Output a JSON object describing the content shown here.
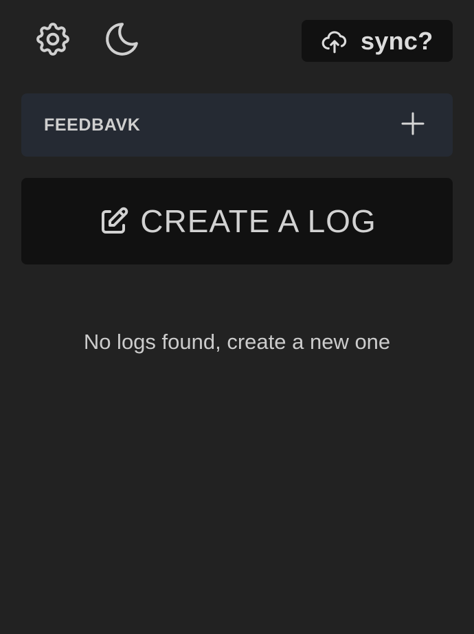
{
  "header": {
    "settings_icon": "gear-icon",
    "theme_icon": "moon-icon",
    "sync": {
      "icon": "cloud-upload-icon",
      "label": "sync?"
    }
  },
  "section": {
    "title": "FEEDBAVK",
    "add_icon": "plus-icon"
  },
  "create_log": {
    "icon": "edit-square-icon",
    "label": "CREATE A LOG"
  },
  "empty_state": {
    "message": "No logs found, create a new one"
  },
  "colors": {
    "background": "#222222",
    "button_dark": "#111111",
    "section_bg": "#252a33",
    "text": "#d4d4d4"
  }
}
